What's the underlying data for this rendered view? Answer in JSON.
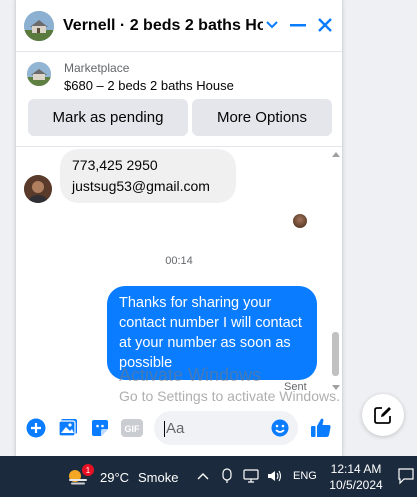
{
  "header": {
    "title": "Vernell · 2 beds 2 baths Ho...",
    "icons": [
      "house-thumbnail",
      "chevron-down-icon",
      "minimize-icon",
      "close-icon"
    ],
    "accent": "#0a7cff"
  },
  "listing": {
    "kind": "Marketplace",
    "price_line": "$680 – 2 beds 2 baths House",
    "mark_pending_label": "Mark as pending",
    "more_options_label": "More Options"
  },
  "messages": {
    "incoming": {
      "line1": "773,425 2950",
      "line2": "justsug53@gmail.com"
    },
    "timestamp": "00:14",
    "outgoing": {
      "text": "Thanks for sharing your contact number I will contact at your number as soon as possible",
      "color": "#0a7cff"
    },
    "status": "Sent"
  },
  "composer": {
    "placeholder": "Aa",
    "icons": [
      "plus-icon",
      "image-icon",
      "sticker-icon",
      "gif-icon",
      "emoji-icon",
      "thumbs-up-icon"
    ],
    "gif_label": "GIF"
  },
  "watermark": {
    "line1": "Activate Windows",
    "line2": "Go to Settings to activate Windows."
  },
  "taskbar": {
    "weather_badge": "1",
    "temperature": "29°C",
    "condition": "Smoke",
    "language": "ENG",
    "time": "12:14 AM",
    "date": "10/5/2024"
  }
}
